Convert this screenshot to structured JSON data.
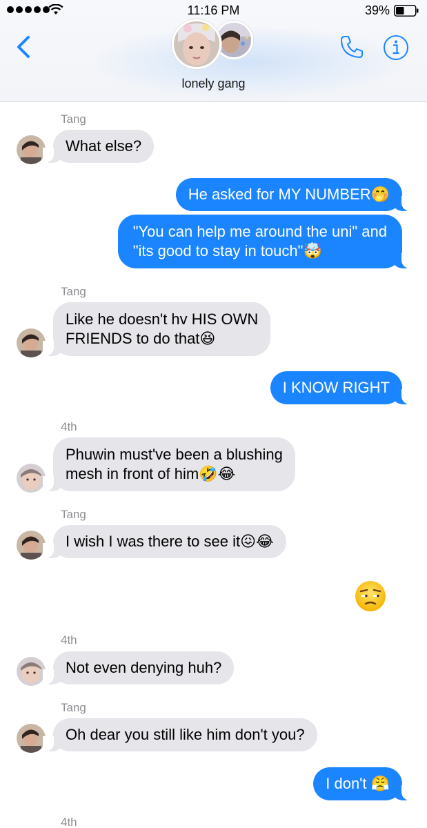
{
  "status_bar": {
    "time": "11:16 PM",
    "battery": "39%"
  },
  "header": {
    "group_name": "lonely gang"
  },
  "messages": {
    "s1": "Tang",
    "m1": "What else?",
    "m2": "He asked for MY NUMBER🤭",
    "m3a": "\"You can help me around the uni\" and",
    "m3b": "\"its good to stay in touch\"🤯",
    "s2": "Tang",
    "m4a": "Like he doesn't hv HIS OWN",
    "m4b": "FRIENDS to do that😆",
    "m5": "I KNOW RIGHT",
    "s3": "4th",
    "m6a": "Phuwin must've been a blushing",
    "m6b": "mesh in front of him🤣😂",
    "s4": "Tang",
    "m7": "I wish I was there to see it😖😂",
    "m8": "😒",
    "s5": "4th",
    "m9": "Not even denying huh?",
    "s6": "Tang",
    "m10": "Oh dear you still like him don't you?",
    "m11": "I don't 😤",
    "s7": "4th"
  },
  "colors": {
    "outgoing_bubble": "#1a85ff",
    "incoming_bubble": "#e5e5ea",
    "accent": "#1a85ff",
    "sender_name": "#8e8e93"
  },
  "icons": [
    "signal-icon",
    "wifi-icon",
    "battery-icon",
    "back-chevron-icon",
    "phone-icon",
    "info-icon"
  ]
}
